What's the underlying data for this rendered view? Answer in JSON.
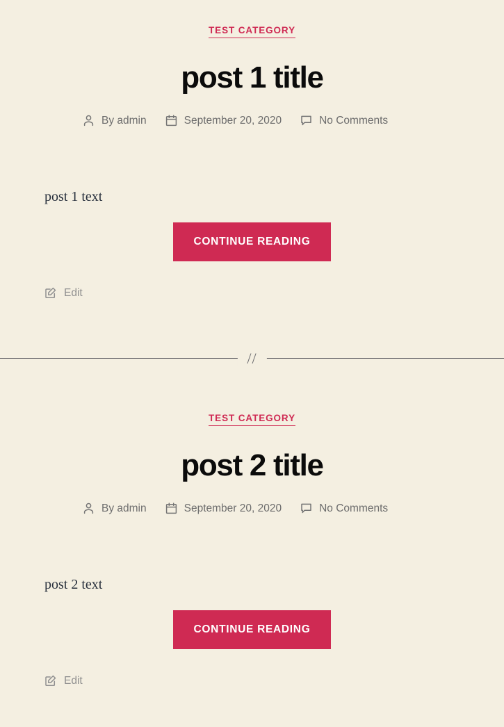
{
  "site": {
    "background_color": "#f4efe1",
    "accent_color": "#cf2a53",
    "text_color": "#28303d",
    "meta_color": "#6d6d6d"
  },
  "separator": {
    "mark": "//"
  },
  "posts": [
    {
      "category": "Test Category",
      "title": "post 1 title",
      "author_prefix": "By",
      "author": "admin",
      "author_line": "By admin",
      "date": "September 20, 2020",
      "comments": "No Comments",
      "excerpt": "post 1 text",
      "more_label": "Continue reading",
      "edit_label": "Edit",
      "icons": {
        "author": "person-icon",
        "date": "calendar-icon",
        "comments": "comment-bubble-icon",
        "edit": "edit-pencil-icon"
      }
    },
    {
      "category": "Test Category",
      "title": "post 2 title",
      "author_prefix": "By",
      "author": "admin",
      "author_line": "By admin",
      "date": "September 20, 2020",
      "comments": "No Comments",
      "excerpt": "post 2 text",
      "more_label": "Continue reading",
      "edit_label": "Edit",
      "icons": {
        "author": "person-icon",
        "date": "calendar-icon",
        "comments": "comment-bubble-icon",
        "edit": "edit-pencil-icon"
      }
    }
  ]
}
